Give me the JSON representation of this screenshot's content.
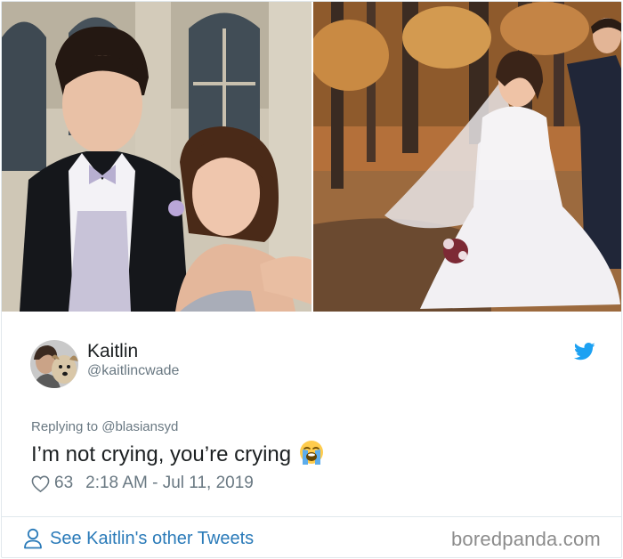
{
  "tweet": {
    "author_name": "Kaitlin",
    "author_handle": "@kaitlincwade",
    "replying_to": "Replying to @blasiansyd",
    "text": "I’m not crying, you’re crying",
    "emoji": "loudly-crying-face-emoji",
    "likes": "63",
    "timestamp": "2:18 AM - Jul 11, 2019"
  },
  "footer": {
    "see_more_label": "See Kaitlin's other Tweets"
  },
  "watermark": "boredpanda.com",
  "colors": {
    "link": "#2b7bb9",
    "muted": "#697882",
    "twitter_blue": "#1da1f2",
    "border": "#e1e8ed"
  },
  "icons": {
    "bird": "twitter-bird-icon",
    "heart": "heart-outline-icon",
    "person": "person-outline-icon"
  }
}
